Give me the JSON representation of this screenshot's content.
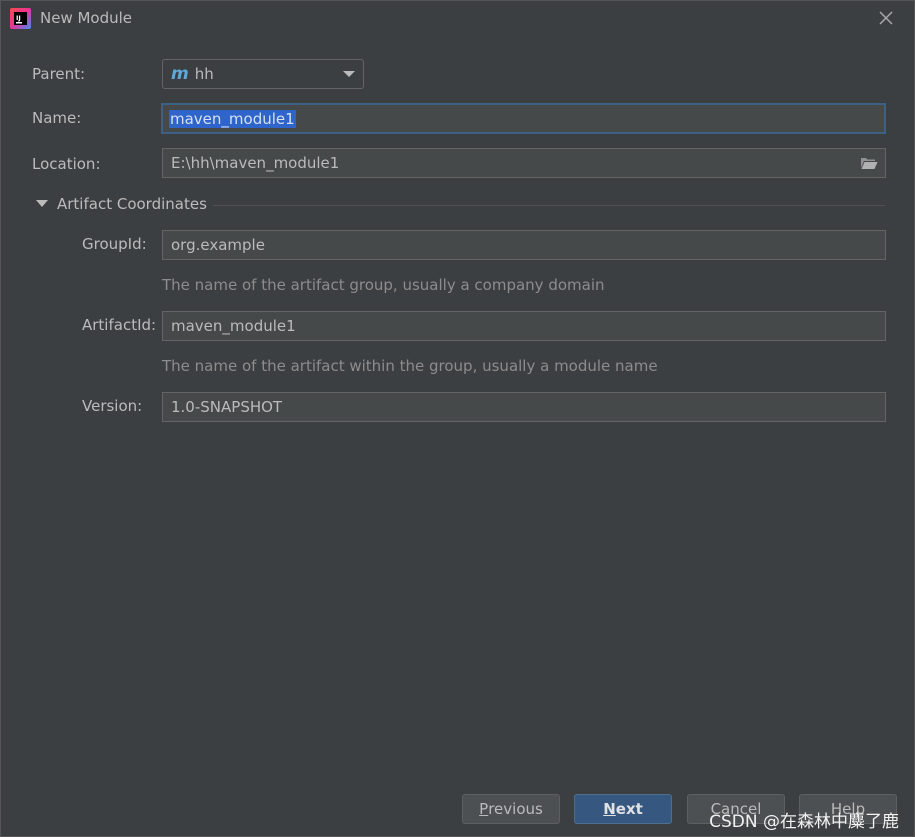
{
  "window": {
    "title": "New Module",
    "app_icon": "intellij-idea-icon",
    "close_icon": "close-icon"
  },
  "form": {
    "parent": {
      "label": "Parent:",
      "value": "hh",
      "icon": "maven-m-icon"
    },
    "name": {
      "label": "Name:",
      "value": "maven_module1"
    },
    "location": {
      "label": "Location:",
      "value": "E:\\hh\\maven_module1",
      "icon": "folder-icon"
    }
  },
  "artifact": {
    "section_label": "Artifact Coordinates",
    "group_id": {
      "label": "GroupId:",
      "value": "org.example",
      "hint": "The name of the artifact group, usually a company domain"
    },
    "artifact_id": {
      "label": "ArtifactId:",
      "value": "maven_module1",
      "hint": "The name of the artifact within the group, usually a module name"
    },
    "version": {
      "label": "Version:",
      "value": "1.0-SNAPSHOT"
    }
  },
  "buttons": {
    "previous": {
      "mnemonic": "P",
      "rest": "revious"
    },
    "next": {
      "mnemonic": "N",
      "rest": "ext"
    },
    "cancel": {
      "label": "Cancel"
    },
    "help": {
      "label": "Help"
    }
  },
  "watermark": "CSDN @在森林中麋了鹿",
  "colors": {
    "background": "#3c3f41",
    "field_bg": "#45494a",
    "focus_border": "#3d6185",
    "selection": "#2f65ca",
    "primary_button": "#365880",
    "maven_icon": "#5ea9d8"
  }
}
